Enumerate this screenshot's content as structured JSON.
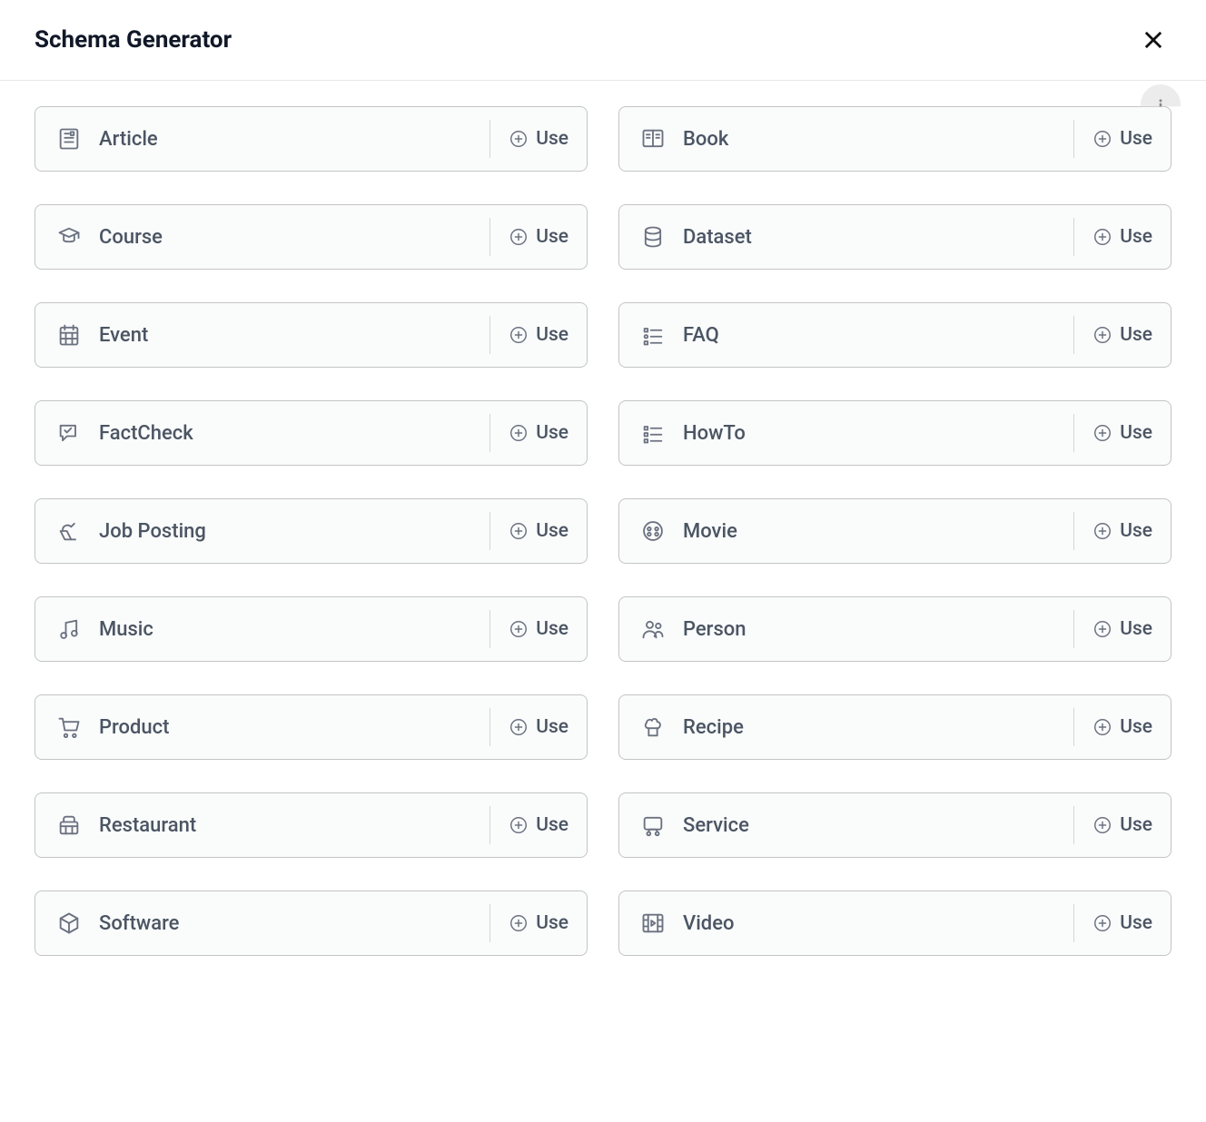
{
  "header": {
    "title": "Schema Generator"
  },
  "use_label": "Use",
  "items": [
    {
      "label": "Article",
      "icon": "article-icon"
    },
    {
      "label": "Book",
      "icon": "book-icon"
    },
    {
      "label": "Course",
      "icon": "course-icon"
    },
    {
      "label": "Dataset",
      "icon": "dataset-icon"
    },
    {
      "label": "Event",
      "icon": "event-icon"
    },
    {
      "label": "FAQ",
      "icon": "faq-icon"
    },
    {
      "label": "FactCheck",
      "icon": "factcheck-icon"
    },
    {
      "label": "HowTo",
      "icon": "howto-icon"
    },
    {
      "label": "Job Posting",
      "icon": "jobposting-icon"
    },
    {
      "label": "Movie",
      "icon": "movie-icon"
    },
    {
      "label": "Music",
      "icon": "music-icon"
    },
    {
      "label": "Person",
      "icon": "person-icon"
    },
    {
      "label": "Product",
      "icon": "product-icon"
    },
    {
      "label": "Recipe",
      "icon": "recipe-icon"
    },
    {
      "label": "Restaurant",
      "icon": "restaurant-icon"
    },
    {
      "label": "Service",
      "icon": "service-icon"
    },
    {
      "label": "Software",
      "icon": "software-icon"
    },
    {
      "label": "Video",
      "icon": "video-icon"
    }
  ]
}
